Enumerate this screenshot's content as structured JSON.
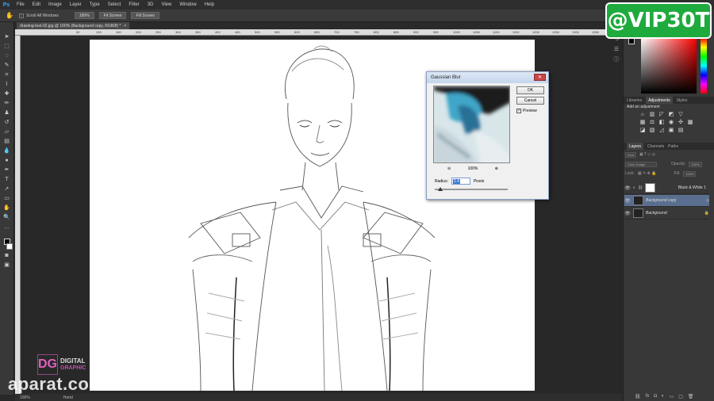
{
  "app": {
    "logo": "Ps"
  },
  "menu": [
    "File",
    "Edit",
    "Image",
    "Layer",
    "Type",
    "Select",
    "Filter",
    "3D",
    "View",
    "Window",
    "Help"
  ],
  "options": {
    "scroll_all_label": "Scroll All Windows",
    "btn_100": "100%",
    "btn_fit": "Fit Screen",
    "btn_fill": "Fill Screen"
  },
  "document": {
    "tab_title": "drawing-test-02.jpg @ 100% (Background copy, RGB/8) *",
    "tab_close": "×"
  },
  "ruler_ticks": [
    "50",
    "100",
    "150",
    "200",
    "250",
    "300",
    "350",
    "400",
    "450",
    "500",
    "550",
    "600",
    "650",
    "700",
    "750",
    "800",
    "850",
    "900",
    "950",
    "1000",
    "1050",
    "1100",
    "1150",
    "1200",
    "1250",
    "1300",
    "1350"
  ],
  "status": {
    "zoom": "100%",
    "tool": "Hand"
  },
  "watermark": {
    "text": "aparat.co",
    "logo_mark": "DG",
    "logo_line1": "DIGITAL",
    "logo_line2": "GRAPHIC"
  },
  "badge": {
    "text": "@VIP30T"
  },
  "colors": {
    "accent": "#1faa3d",
    "ps_blue": "#31a8ff",
    "layer_selected": "#5a6f8f"
  },
  "panels": {
    "top_tabs": [
      "Libraries",
      "Adjustments",
      "Styles"
    ],
    "adjust_title": "Add an adjustment",
    "layer_tabs": [
      "Layers",
      "Channels",
      "Paths"
    ],
    "kind_label": "Kind",
    "blend_mode": "Color Dodge",
    "opacity_label": "Opacity:",
    "opacity_value": "100%",
    "lock_label": "Lock:",
    "fill_label": "Fill:",
    "fill_value": "100%",
    "layers": [
      {
        "name": "Black & White 1"
      },
      {
        "name": "Background copy"
      },
      {
        "name": "Background"
      }
    ]
  },
  "dialog": {
    "title": "Gaussian Blur",
    "ok": "OK",
    "cancel": "Cancel",
    "preview_label": "Preview",
    "zoom_value": "100%",
    "radius_label": "Radius:",
    "radius_value": "1.4",
    "unit": "Pixels"
  }
}
